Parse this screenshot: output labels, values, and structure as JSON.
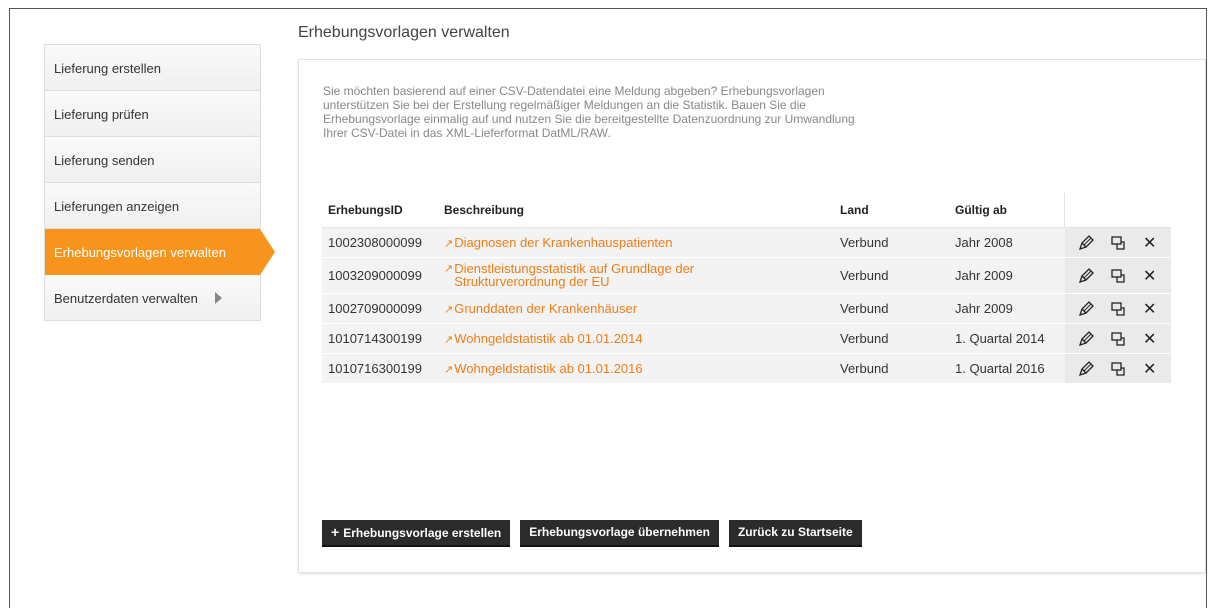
{
  "page": {
    "title": "Erhebungsvorlagen verwalten"
  },
  "sidebar": {
    "items": [
      {
        "label": "Lieferung erstellen"
      },
      {
        "label": "Lieferung prüfen"
      },
      {
        "label": "Lieferung senden"
      },
      {
        "label": "Lieferungen anzeigen"
      },
      {
        "label": "Erhebungsvorlagen verwalten",
        "active": true
      },
      {
        "label": "Benutzerdaten verwalten",
        "has_submenu": true
      }
    ]
  },
  "intro": {
    "text": "Sie möchten basierend auf einer CSV-Datendatei eine Meldung abgeben? Erhebungsvorlagen unterstützen Sie bei der Erstellung regelmäßiger Meldungen an die Statistik. Bauen Sie die Erhebungsvorlage einmalig auf und nutzen Sie die bereitgestellte Datenzuordnung zur Umwandlung Ihrer CSV-Datei in das XML-Lieferformat DatML/RAW."
  },
  "table": {
    "headers": {
      "id": "ErhebungsID",
      "desc": "Beschreibung",
      "land": "Land",
      "valid": "Gültig ab"
    },
    "rows": [
      {
        "id": "1002308000099",
        "desc": "Diagnosen der Krankenhauspatienten",
        "land": "Verbund",
        "valid": "Jahr 2008"
      },
      {
        "id": "1003209000099",
        "desc": "Dienstleistungsstatistik auf Grundlage der Strukturverordnung der EU",
        "land": "Verbund",
        "valid": "Jahr 2009"
      },
      {
        "id": "1002709000099",
        "desc": "Grunddaten der Krankenhäuser",
        "land": "Verbund",
        "valid": "Jahr 2009"
      },
      {
        "id": "1010714300199",
        "desc": "Wohngeldstatistik ab 01.01.2014",
        "land": "Verbund",
        "valid": "1. Quartal 2014"
      },
      {
        "id": "1010716300199",
        "desc": "Wohngeldstatistik ab 01.01.2016",
        "land": "Verbund",
        "valid": "1. Quartal 2016"
      }
    ],
    "row_icons": [
      "edit-icon",
      "copy-icon",
      "delete-icon"
    ]
  },
  "buttons": {
    "create": "Erhebungsvorlage erstellen",
    "adopt": "Erhebungsvorlage übernehmen",
    "back": "Zurück zu Startseite"
  },
  "colors": {
    "accent": "#f7941d",
    "link": "#f07d17",
    "button_bg": "#2b2b2b"
  }
}
